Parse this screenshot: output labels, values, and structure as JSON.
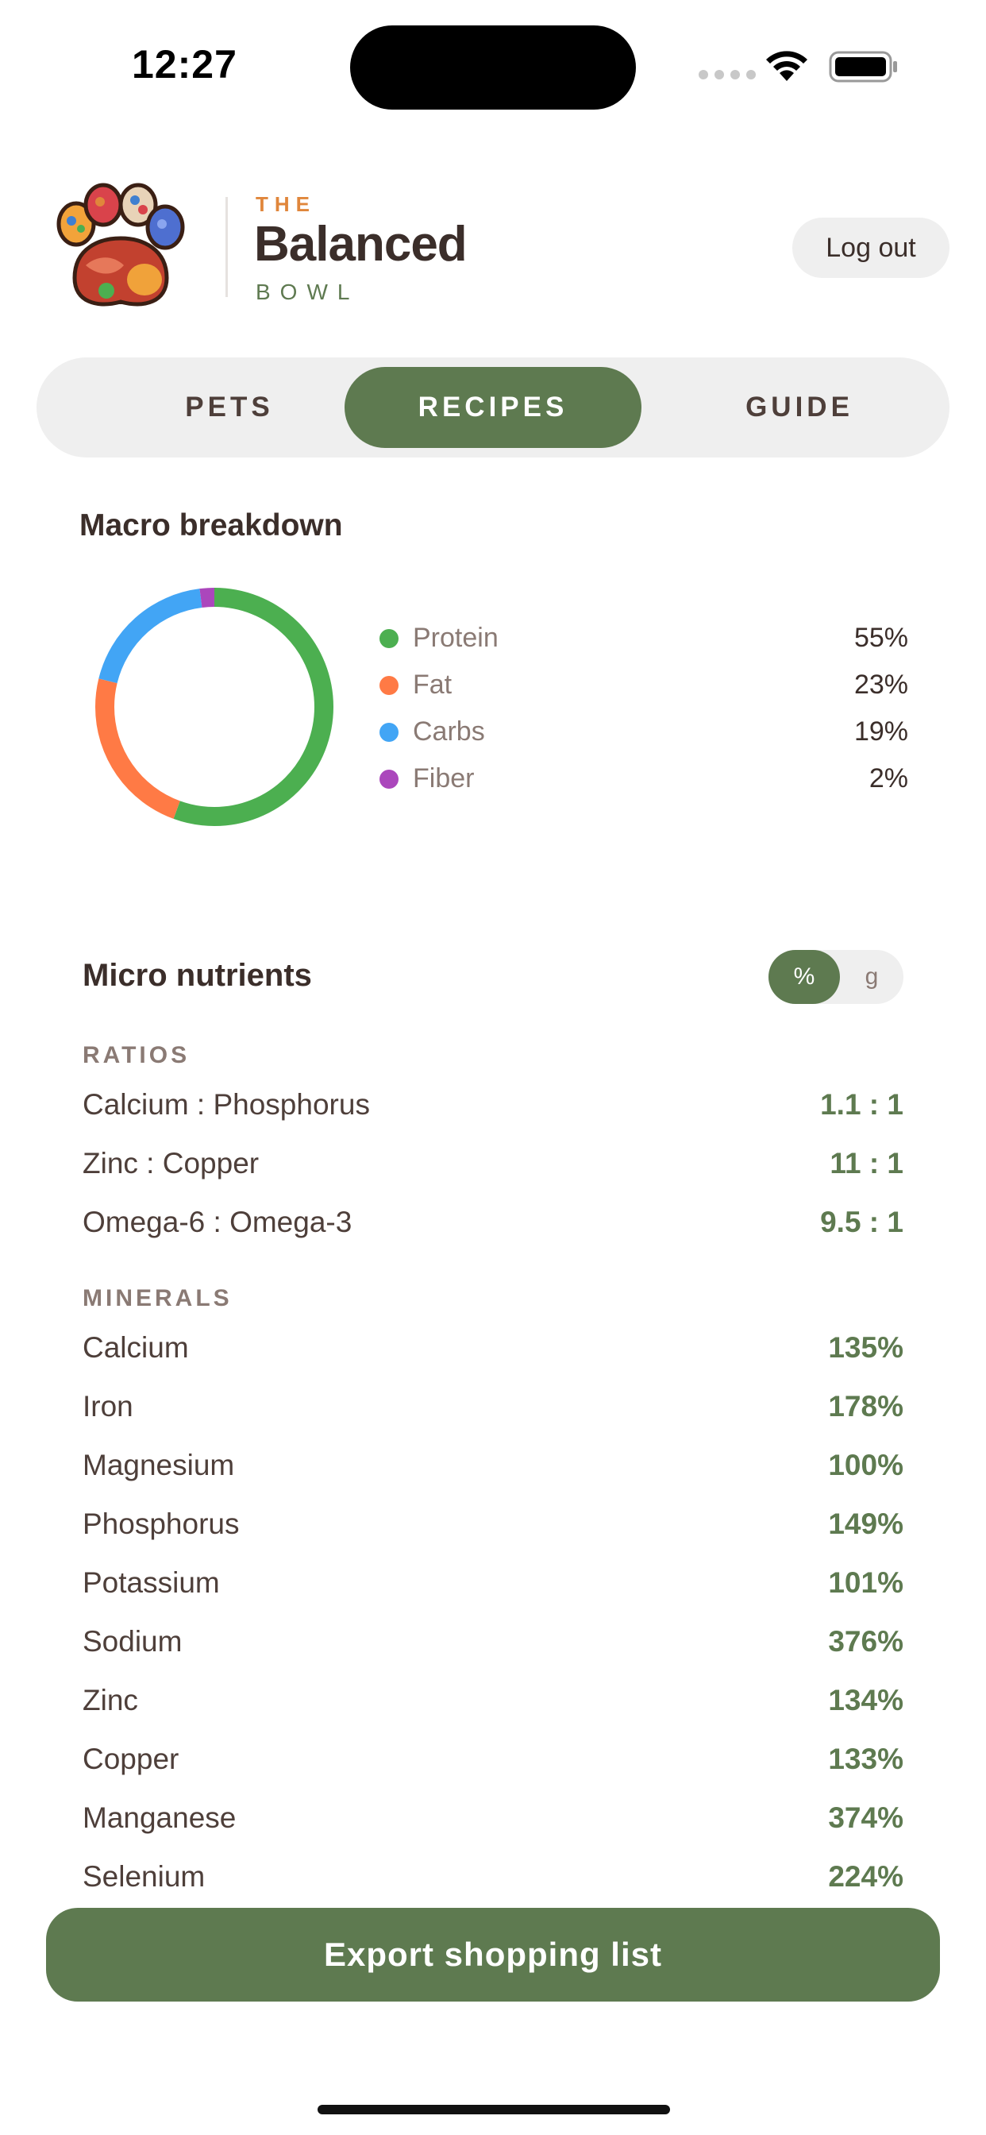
{
  "status_bar": {
    "time": "12:27"
  },
  "header": {
    "brand_the": "THE",
    "brand_name": "Balanced",
    "brand_bowl": "BOWL",
    "logout_label": "Log out"
  },
  "tabs": [
    {
      "label": "PETS",
      "active": false
    },
    {
      "label": "RECIPES",
      "active": true
    },
    {
      "label": "GUIDE",
      "active": false
    }
  ],
  "macro": {
    "title": "Macro breakdown",
    "items": [
      {
        "name": "Protein",
        "value": "55%",
        "color": "#4caf50"
      },
      {
        "name": "Fat",
        "value": "23%",
        "color": "#ff7a45"
      },
      {
        "name": "Carbs",
        "value": "19%",
        "color": "#42a5f5"
      },
      {
        "name": "Fiber",
        "value": "2%",
        "color": "#ab47bc"
      }
    ]
  },
  "chart_data": {
    "type": "pie",
    "categories": [
      "Protein",
      "Fat",
      "Carbs",
      "Fiber"
    ],
    "values": [
      55,
      23,
      19,
      2
    ],
    "colors": [
      "#4caf50",
      "#ff7a45",
      "#42a5f5",
      "#ab47bc"
    ],
    "title": "Macro breakdown",
    "legend": "right"
  },
  "micro": {
    "title": "Micro nutrients",
    "toggle": {
      "percent_label": "%",
      "gram_label": "g",
      "selected": "%"
    },
    "ratios_label": "RATIOS",
    "ratios": [
      {
        "name": "Calcium : Phosphorus",
        "value": "1.1 : 1"
      },
      {
        "name": "Zinc : Copper",
        "value": "11 : 1"
      },
      {
        "name": "Omega-6 : Omega-3",
        "value": "9.5 : 1"
      }
    ],
    "minerals_label": "MINERALS",
    "minerals": [
      {
        "name": "Calcium",
        "value": "135%"
      },
      {
        "name": "Iron",
        "value": "178%"
      },
      {
        "name": "Magnesium",
        "value": "100%"
      },
      {
        "name": "Phosphorus",
        "value": "149%"
      },
      {
        "name": "Potassium",
        "value": "101%"
      },
      {
        "name": "Sodium",
        "value": "376%"
      },
      {
        "name": "Zinc",
        "value": "134%"
      },
      {
        "name": "Copper",
        "value": "133%"
      },
      {
        "name": "Manganese",
        "value": "374%"
      },
      {
        "name": "Selenium",
        "value": "224%"
      }
    ]
  },
  "export_label": "Export shopping list",
  "icons": {
    "logo": "paw-food-logo-icon",
    "wifi": "wifi-icon",
    "battery": "battery-icon",
    "signal": "cellular-signal-icon"
  }
}
